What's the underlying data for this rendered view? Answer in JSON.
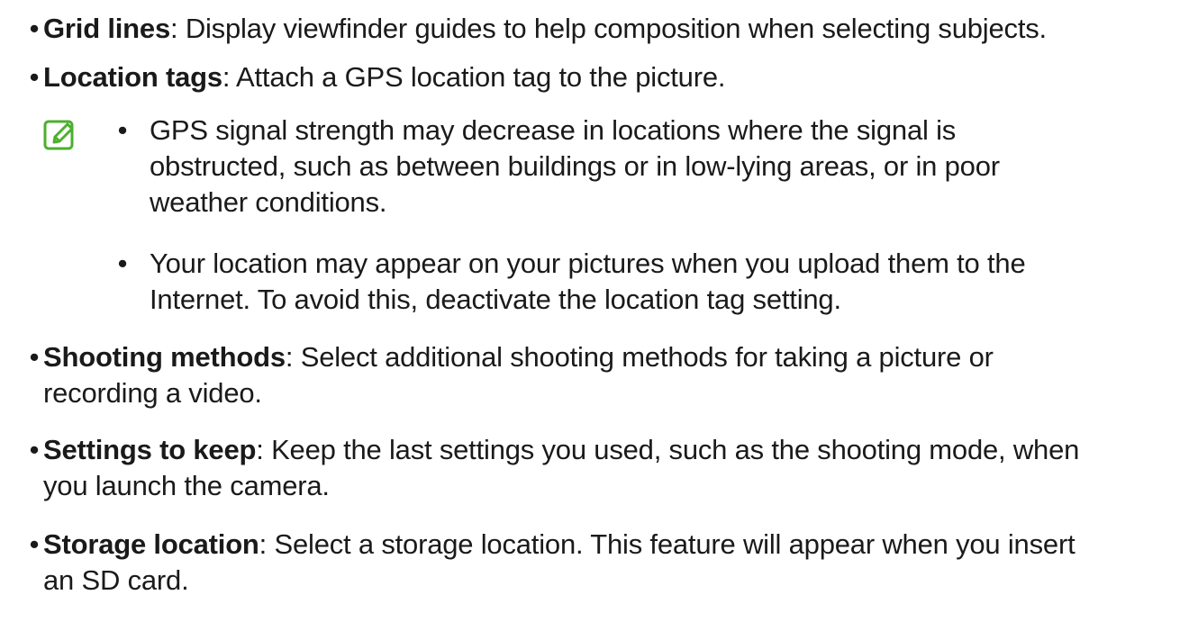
{
  "bullet_glyph": "•",
  "items_top": [
    {
      "term": "Grid lines",
      "sep": ": ",
      "desc": "Display viewfinder guides to help composition when selecting subjects."
    },
    {
      "term": "Location tags",
      "sep": ": ",
      "desc": "Attach a GPS location tag to the picture."
    }
  ],
  "note": {
    "icon": "note-pencil-icon",
    "icon_color": "#4caf2e",
    "items": [
      {
        "lines": [
          "GPS signal strength may decrease in locations where the signal is",
          "obstructed, such as between buildings or in low-lying areas, or in poor",
          "weather conditions."
        ]
      },
      {
        "lines": [
          "Your location may appear on your pictures when you upload them to the",
          "Internet. To avoid this, deactivate the location tag setting."
        ]
      }
    ]
  },
  "items_bottom": [
    {
      "term": "Shooting methods",
      "sep": ": ",
      "lines": [
        "Select additional shooting methods for taking a picture or",
        "recording a video."
      ]
    },
    {
      "term": "Settings to keep",
      "sep": ": ",
      "lines": [
        "Keep the last settings you used, such as the shooting mode, when",
        "you launch the camera."
      ]
    },
    {
      "term": "Storage location",
      "sep": ": ",
      "lines": [
        "Select a storage location. This feature will appear when you insert",
        "an SD card."
      ]
    }
  ]
}
